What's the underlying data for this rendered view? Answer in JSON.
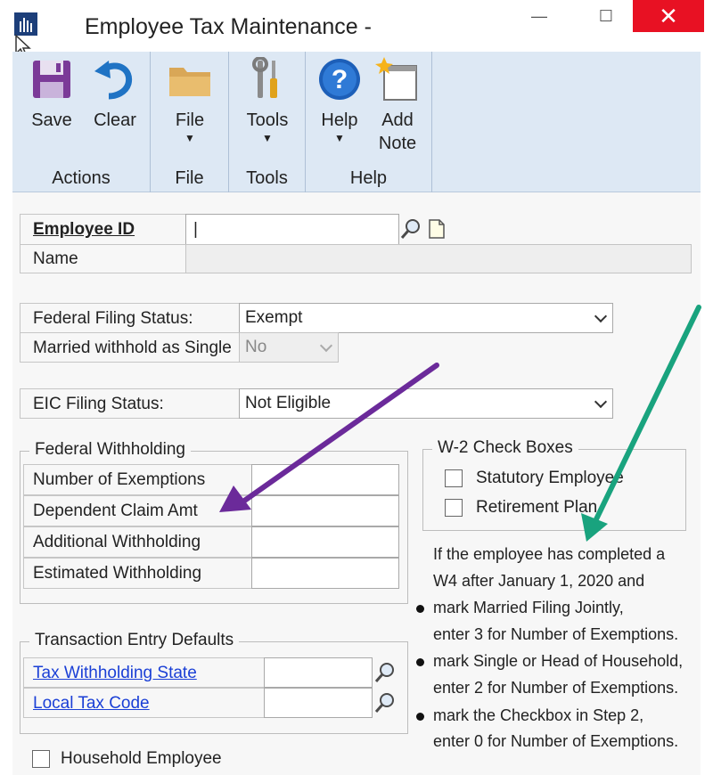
{
  "window": {
    "title": "Employee Tax Maintenance  -",
    "minimize_glyph": "—",
    "maximize_glyph": "☐",
    "close_glyph": "✕"
  },
  "ribbon": {
    "groups": {
      "actions": "Actions",
      "file": "File",
      "tools": "Tools",
      "help": "Help"
    },
    "buttons": {
      "save": "Save",
      "clear": "Clear",
      "file": "File",
      "tools": "Tools",
      "help": "Help",
      "add_note_1": "Add",
      "add_note_2": "Note"
    },
    "caret": "▼"
  },
  "form": {
    "employee_id_label": "Employee ID",
    "employee_id_value": "|",
    "name_label": "Name",
    "federal_filing_status_label": "Federal Filing Status:",
    "federal_filing_status_value": "Exempt",
    "married_single_label": "Married withhold as Single",
    "married_single_value": "No",
    "eic_filing_status_label": "EIC Filing Status:",
    "eic_filing_status_value": "Not Eligible",
    "federal_withholding": {
      "title": "Federal Withholding",
      "rows": [
        "Number of Exemptions",
        "Dependent Claim Amt",
        "Additional Withholding",
        "Estimated Withholding"
      ]
    },
    "w2_checkboxes": {
      "title": "W-2 Check Boxes",
      "statutory": "Statutory Employee",
      "retirement": "Retirement Plan"
    },
    "transaction_defaults": {
      "title": "Transaction Entry Defaults",
      "tax_state": "Tax Withholding State",
      "local_tax": "Local Tax Code"
    },
    "household_employee": "Household Employee"
  },
  "note": {
    "intro_1": "If the employee has completed a",
    "intro_2": "W4 after January 1, 2020 and",
    "b1_1": "mark Married Filing Jointly,",
    "b1_2": "enter 3 for Number of Exemptions.",
    "b2_1": "mark Single or Head of Household,",
    "b2_2": "enter 2 for Number of Exemptions.",
    "b3_1": "mark the Checkbox in Step 2,",
    "b3_2": "enter 0 for Number of Exemptions."
  },
  "colors": {
    "ribbon_bg": "#dde8f4",
    "close_red": "#e81123",
    "link_blue": "#1a3fd6",
    "arrow_purple": "#6b2a9a",
    "arrow_green": "#19a37e"
  },
  "icons": {
    "save": "floppy-disk-icon",
    "clear": "undo-arrow-icon",
    "file": "folder-icon",
    "tools": "wrench-screwdriver-icon",
    "help": "question-mark-icon",
    "add_note": "add-note-icon",
    "lookup": "magnifier-icon",
    "new": "blank-page-icon"
  }
}
